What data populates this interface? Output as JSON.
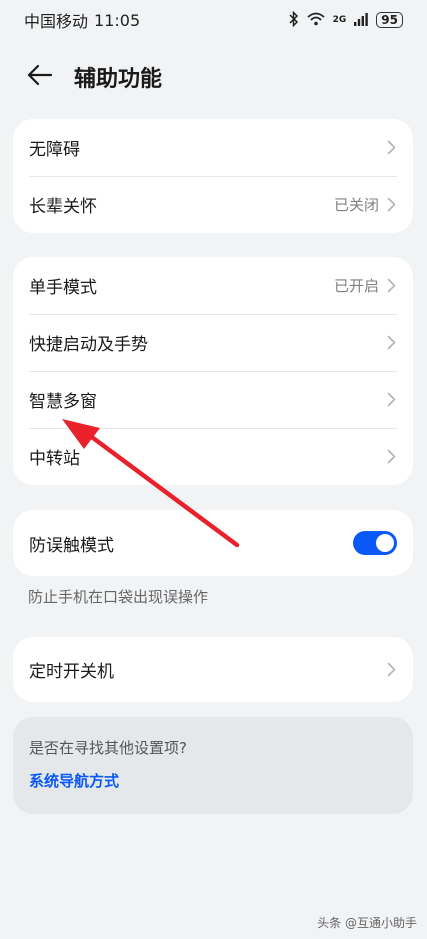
{
  "status_bar": {
    "carrier": "中国移动",
    "time": "11:05",
    "network": "2G",
    "battery": "95"
  },
  "header": {
    "title": "辅助功能"
  },
  "group1": [
    {
      "label": "无障碍",
      "value": ""
    },
    {
      "label": "长辈关怀",
      "value": "已关闭"
    }
  ],
  "group2": [
    {
      "label": "单手模式",
      "value": "已开启"
    },
    {
      "label": "快捷启动及手势",
      "value": ""
    },
    {
      "label": "智慧多窗",
      "value": ""
    },
    {
      "label": "中转站",
      "value": ""
    }
  ],
  "mistouch": {
    "label": "防误触模式",
    "enabled": true,
    "hint": "防止手机在口袋出现误操作"
  },
  "group3": [
    {
      "label": "定时开关机",
      "value": ""
    }
  ],
  "suggest": {
    "question": "是否在寻找其他设置项?",
    "link": "系统导航方式"
  },
  "watermark": "头条 @互通小助手",
  "colors": {
    "background": "#f1f3f5",
    "accent": "#0a59f7",
    "annotation_arrow": "#e8212b"
  },
  "icons": {
    "back": "arrow-left-icon",
    "chevron": "chevron-right-icon",
    "bluetooth": "bluetooth-icon",
    "wifi": "wifi-icon",
    "signal": "signal-icon"
  }
}
